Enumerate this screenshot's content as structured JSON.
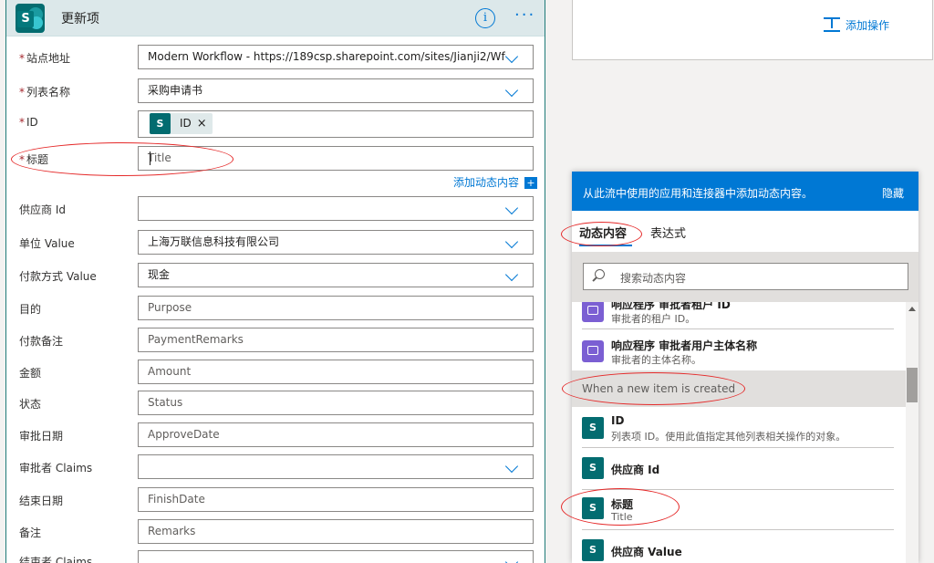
{
  "action_card": {
    "title": "更新项",
    "fields": [
      {
        "label": "站点地址",
        "required": true,
        "value": "Modern Workflow - https://189csp.sharepoint.com/sites/Jianji2/Wf",
        "dropdown": true
      },
      {
        "label": "列表名称",
        "required": true,
        "value": "采购申请书",
        "dropdown": true
      },
      {
        "label": "ID",
        "required": true,
        "token": "ID"
      },
      {
        "label": "标题",
        "required": true,
        "placeholder": "Title"
      },
      {
        "label": "供应商 Id",
        "required": false,
        "value": "",
        "dropdown": true
      },
      {
        "label": "单位 Value",
        "required": false,
        "value": "上海万联信息科技有限公司",
        "dropdown": true
      },
      {
        "label": "付款方式 Value",
        "required": false,
        "value": "现金",
        "dropdown": true
      },
      {
        "label": "目的",
        "required": false,
        "placeholder": "Purpose"
      },
      {
        "label": "付款备注",
        "required": false,
        "placeholder": "PaymentRemarks"
      },
      {
        "label": "金额",
        "required": false,
        "placeholder": "Amount"
      },
      {
        "label": "状态",
        "required": false,
        "placeholder": "Status"
      },
      {
        "label": "审批日期",
        "required": false,
        "placeholder": "ApproveDate"
      },
      {
        "label": "审批者 Claims",
        "required": false,
        "value": "",
        "dropdown": true
      },
      {
        "label": "结束日期",
        "required": false,
        "placeholder": "FinishDate"
      },
      {
        "label": "备注",
        "required": false,
        "placeholder": "Remarks"
      },
      {
        "label": "结束者 Claims",
        "required": false,
        "value": "",
        "dropdown": true
      }
    ],
    "add_dynamic_content": "添加动态内容"
  },
  "add_action": "添加操作",
  "dynamic_panel": {
    "header": "从此流中使用的应用和连接器中添加动态内容。",
    "hide": "隐藏",
    "tabs": [
      "动态内容",
      "表达式"
    ],
    "search_placeholder": "搜索动态内容",
    "items_top": [
      {
        "name": "响应程序 审批者租户 ID",
        "desc": "审批者的租户 ID。",
        "icon": "approval-icon"
      },
      {
        "name": "响应程序 审批者用户主体名称",
        "desc": "审批者的主体名称。",
        "icon": "approval-icon"
      }
    ],
    "section": "When a new item is created",
    "items_bottom": [
      {
        "name": "ID",
        "desc": "列表项 ID。使用此值指定其他列表相关操作的对象。",
        "icon": "sharepoint-icon"
      },
      {
        "name": "供应商 Id",
        "desc": "",
        "icon": "sharepoint-icon"
      },
      {
        "name": "标题",
        "desc": "Title",
        "icon": "sharepoint-icon"
      },
      {
        "name": "供应商 Value",
        "desc": "",
        "icon": "sharepoint-icon"
      }
    ]
  },
  "colors": {
    "accent": "#0078d4",
    "header_bg": "#dce8ea",
    "annotation": "#e52a2a",
    "sharepoint": "#036c70"
  }
}
